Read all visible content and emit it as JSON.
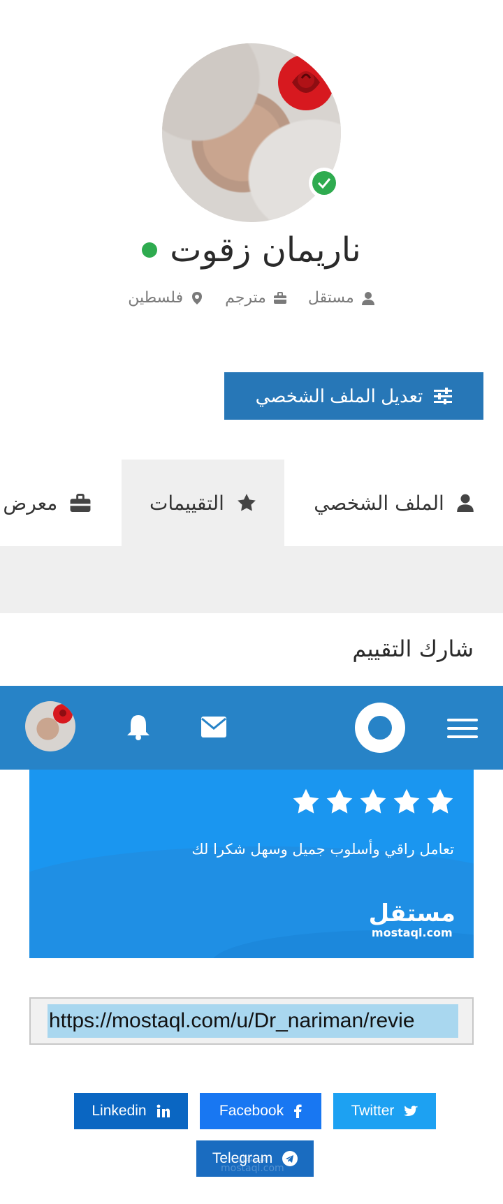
{
  "profile": {
    "name": "ناريمان زقوت",
    "role": "مستقل",
    "job": "مترجم",
    "location": "فلسطين",
    "status_color": "#2eab4f"
  },
  "actions": {
    "edit_profile": "تعديل الملف الشخصي"
  },
  "tabs": [
    {
      "label": "الملف الشخصي",
      "icon": "user-icon"
    },
    {
      "label": "التقييمات",
      "icon": "star-icon",
      "active": true
    },
    {
      "label": "معرض ا",
      "icon": "briefcase-icon"
    }
  ],
  "share": {
    "title": "شارك التقييم",
    "review_text": "تعامل راقي وأسلوب جميل وسهل شكرا لك",
    "rating": 5,
    "logo_ar": "مستقل",
    "logo_en": "mostaql.com",
    "url": "https://mostaql.com/u/Dr_nariman/revie"
  },
  "navbar": {
    "menu_icon": "hamburger-icon",
    "logo_icon": "mostaql-logo-icon",
    "mail_icon": "envelope-icon",
    "bell_icon": "bell-icon"
  },
  "share_buttons": {
    "linkedin": "Linkedin",
    "facebook": "Facebook",
    "twitter": "Twitter",
    "telegram": "Telegram"
  },
  "watermark": {
    "ar": "مستقل",
    "en": "mostaql.com"
  },
  "colors": {
    "primary": "#2777b7",
    "navbar": "#2783c7",
    "card": "#1a96f0",
    "tab_active_bg": "#efefef"
  }
}
